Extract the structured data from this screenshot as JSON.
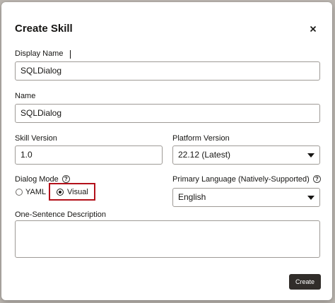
{
  "dialog": {
    "title": "Create Skill",
    "close_icon": "close-icon"
  },
  "display_name": {
    "label": "Display Name",
    "value": "SQLDialog"
  },
  "name": {
    "label": "Name",
    "value": "SQLDialog"
  },
  "skill_version": {
    "label": "Skill Version",
    "value": "1.0"
  },
  "platform_version": {
    "label": "Platform Version",
    "value": "22.12 (Latest)"
  },
  "dialog_mode": {
    "label": "Dialog Mode",
    "help_icon": "help-icon",
    "options": [
      {
        "label": "YAML",
        "selected": false
      },
      {
        "label": "Visual",
        "selected": true
      }
    ]
  },
  "primary_language": {
    "label": "Primary Language (Natively-Supported)",
    "help_icon": "help-icon",
    "value": "English"
  },
  "description": {
    "label": "One-Sentence Description",
    "value": ""
  },
  "buttons": {
    "create_label": "Create"
  },
  "colors": {
    "highlight": "#b3101a",
    "primary_button": "#312d2a"
  }
}
